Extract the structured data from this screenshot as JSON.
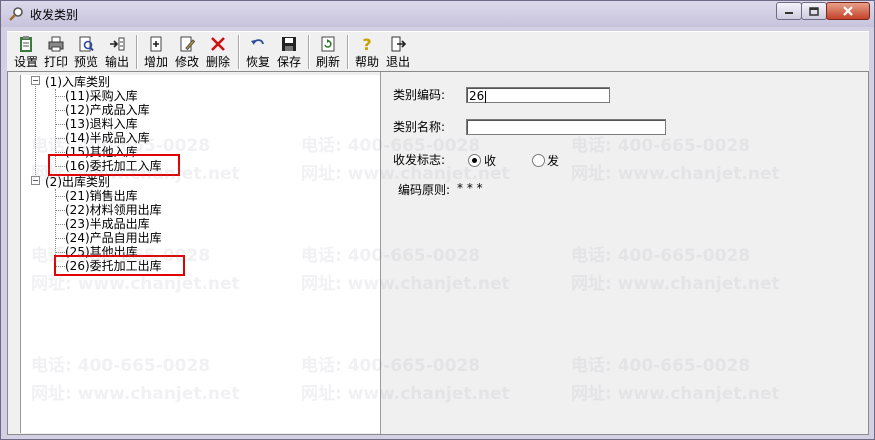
{
  "window": {
    "title": "收发类别"
  },
  "toolbar": {
    "buttons": [
      {
        "name": "settings",
        "label": "设置",
        "icon": "clipboard-icon"
      },
      {
        "name": "print",
        "label": "打印",
        "icon": "printer-icon"
      },
      {
        "name": "preview",
        "label": "预览",
        "icon": "preview-icon"
      },
      {
        "name": "export",
        "label": "输出",
        "icon": "export-icon"
      },
      {
        "name": "add",
        "label": "增加",
        "icon": "new-doc-icon"
      },
      {
        "name": "modify",
        "label": "修改",
        "icon": "edit-icon"
      },
      {
        "name": "delete",
        "label": "删除",
        "icon": "delete-x-icon"
      },
      {
        "name": "restore",
        "label": "恢复",
        "icon": "undo-icon"
      },
      {
        "name": "save",
        "label": "保存",
        "icon": "floppy-icon"
      },
      {
        "name": "refresh",
        "label": "刷新",
        "icon": "refresh-icon"
      },
      {
        "name": "help",
        "label": "帮助",
        "icon": "help-icon"
      },
      {
        "name": "exit",
        "label": "退出",
        "icon": "exit-door-icon"
      }
    ]
  },
  "tree": {
    "groups": [
      {
        "label": "(1)入库类别",
        "items": [
          "(11)采购入库",
          "(12)产成品入库",
          "(13)退料入库",
          "(14)半成品入库",
          "(15)其他入库",
          "(16)委托加工入库"
        ]
      },
      {
        "label": "(2)出库类别",
        "items": [
          "(21)销售出库",
          "(22)材料领用出库",
          "(23)半成品出库",
          "(24)产品自用出库",
          "(25)其他出库",
          "(26)委托加工出库"
        ]
      }
    ]
  },
  "form": {
    "code_label": "类别编码:",
    "code_value": "26",
    "name_label": "类别名称:",
    "name_value": "",
    "flag_label": "收发标志:",
    "flag_options": [
      "收",
      "发"
    ],
    "flag_selected": "收",
    "rule_label": "编码原则:",
    "rule_value": "* * *"
  },
  "watermark": {
    "phone": "电话: 400-665-0028",
    "site": "网址: www.chanjet.net"
  },
  "colors": {
    "highlight": "#e00000",
    "titlebar": "#d3d0e4"
  }
}
